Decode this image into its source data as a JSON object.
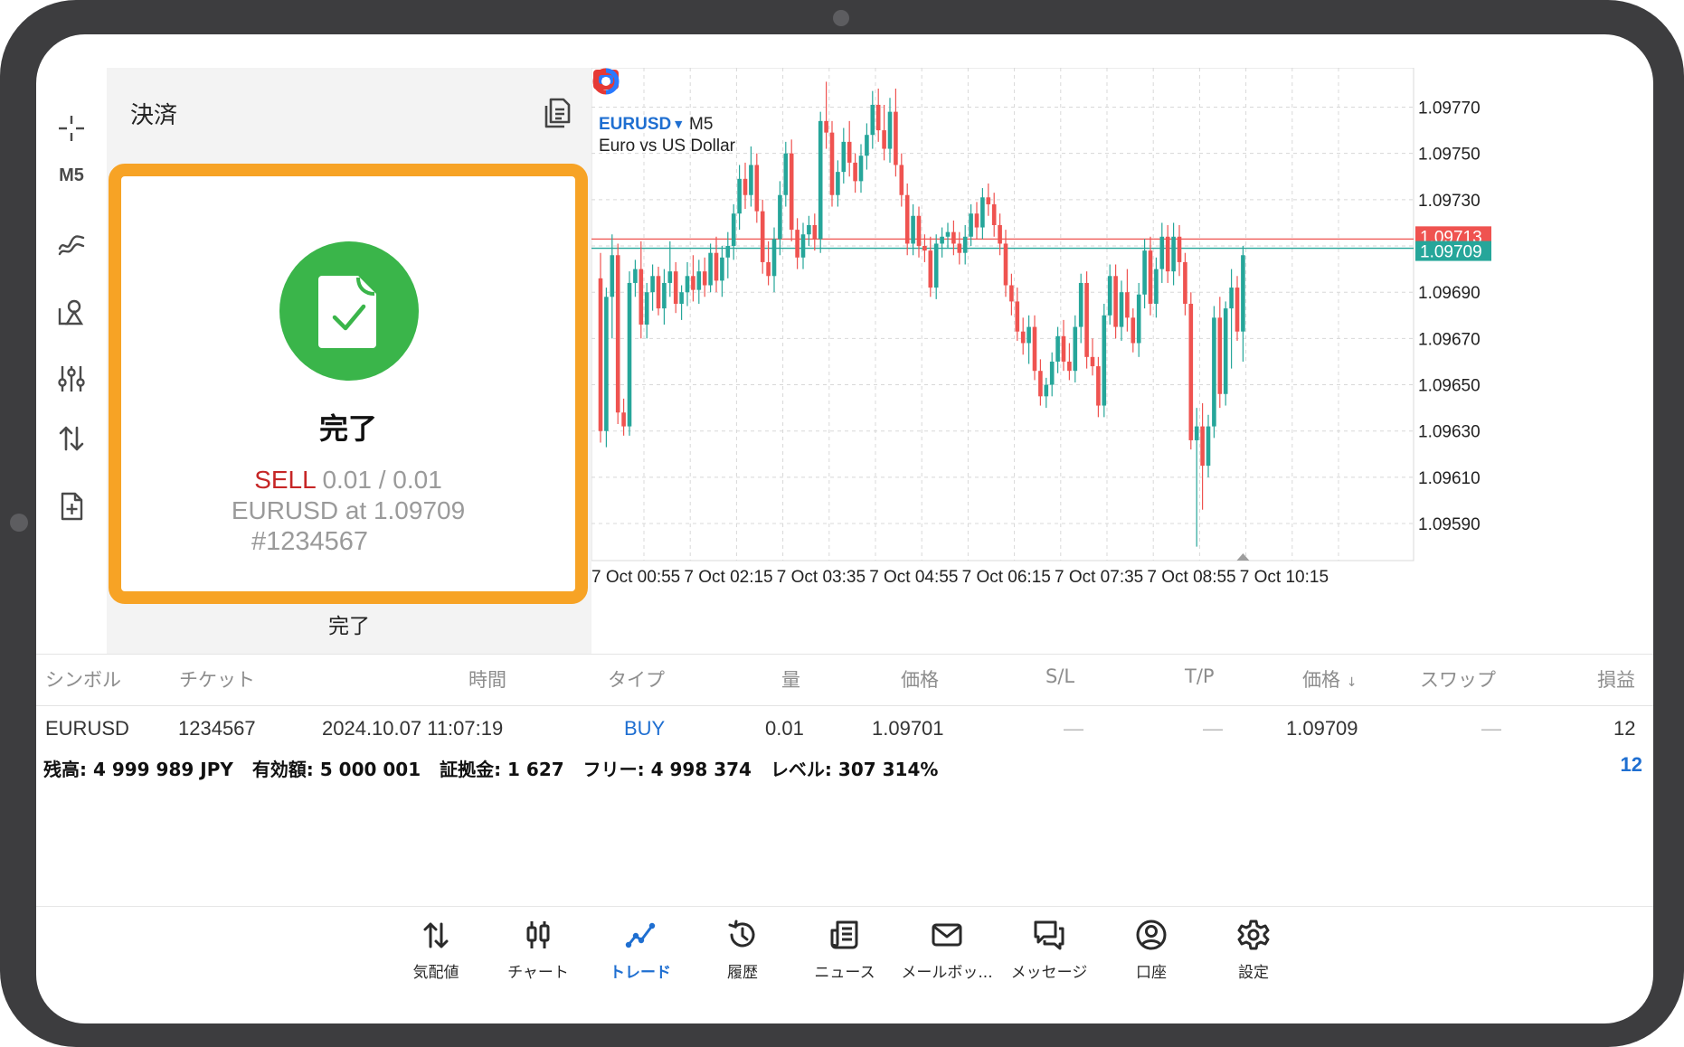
{
  "toolbar": {
    "timeframe": "M5",
    "icons": [
      "crosshair-icon",
      "indicator-icon",
      "objects-icon",
      "settings-sliders-icon",
      "trade-arrows-icon",
      "new-order-icon"
    ]
  },
  "order_panel": {
    "title": "決済",
    "result_title": "完了",
    "side": "SELL",
    "volume_text": "0.01 / 0.01",
    "instrument_text": "EURUSD at 1.09709",
    "ticket_text": "#1234567",
    "done_button": "完了",
    "accent_color": "#f7a325",
    "success_color": "#3ab54a"
  },
  "chart": {
    "symbol": "EURUSD",
    "timeframe": "M5",
    "description": "Euro vs US Dollar",
    "up_color": "#26a69a",
    "down_color": "#ef5350"
  },
  "chart_data": {
    "type": "candlestick",
    "y_ticks": [
      "1.09770",
      "1.09750",
      "1.09730",
      "1.09690",
      "1.09670",
      "1.09650",
      "1.09630",
      "1.09610",
      "1.09590"
    ],
    "y_tick_values": [
      1.0977,
      1.0975,
      1.0973,
      1.0969,
      1.0967,
      1.0965,
      1.0963,
      1.0961,
      1.0959
    ],
    "ylim": [
      1.09574,
      1.09787
    ],
    "x_ticks": [
      "7 Oct 00:55",
      "7 Oct 02:15",
      "7 Oct 03:35",
      "7 Oct 04:55",
      "7 Oct 06:15",
      "7 Oct 07:35",
      "7 Oct 08:55",
      "7 Oct 10:15"
    ],
    "x_tick_index": [
      0,
      16,
      32,
      48,
      64,
      80,
      96,
      112
    ],
    "levels": [
      {
        "label": "1.09713",
        "value": 1.09713,
        "color": "#ef5350"
      },
      {
        "label": "1.09709",
        "value": 1.09709,
        "color": "#26a69a"
      }
    ],
    "grid": true,
    "ohlc": [
      [
        1.09696,
        1.09707,
        1.09625,
        1.0963
      ],
      [
        1.0963,
        1.09692,
        1.09623,
        1.09688
      ],
      [
        1.09688,
        1.09715,
        1.0967,
        1.09706
      ],
      [
        1.09706,
        1.09711,
        1.09633,
        1.09638
      ],
      [
        1.09638,
        1.09644,
        1.09628,
        1.09632
      ],
      [
        1.09632,
        1.09699,
        1.09628,
        1.09694
      ],
      [
        1.09694,
        1.09704,
        1.09688,
        1.097
      ],
      [
        1.097,
        1.09712,
        1.0967,
        1.09676
      ],
      [
        1.09676,
        1.09694,
        1.0967,
        1.0969
      ],
      [
        1.0969,
        1.09702,
        1.09682,
        1.09697
      ],
      [
        1.09697,
        1.09701,
        1.0968,
        1.09683
      ],
      [
        1.09683,
        1.097,
        1.09676,
        1.09694
      ],
      [
        1.09694,
        1.09712,
        1.09688,
        1.09699
      ],
      [
        1.09699,
        1.09703,
        1.09681,
        1.09685
      ],
      [
        1.09685,
        1.09693,
        1.09678,
        1.0969
      ],
      [
        1.0969,
        1.09703,
        1.09684,
        1.09697
      ],
      [
        1.09697,
        1.09706,
        1.09686,
        1.09691
      ],
      [
        1.09691,
        1.09704,
        1.09685,
        1.09699
      ],
      [
        1.09699,
        1.09705,
        1.09688,
        1.09693
      ],
      [
        1.09693,
        1.09711,
        1.0969,
        1.09707
      ],
      [
        1.09707,
        1.09714,
        1.0969,
        1.09695
      ],
      [
        1.09695,
        1.0971,
        1.09688,
        1.09705
      ],
      [
        1.09705,
        1.09716,
        1.09696,
        1.0971
      ],
      [
        1.0971,
        1.09728,
        1.09704,
        1.09724
      ],
      [
        1.09724,
        1.09745,
        1.09717,
        1.09739
      ],
      [
        1.09739,
        1.09746,
        1.09726,
        1.09732
      ],
      [
        1.09732,
        1.09753,
        1.09727,
        1.09745
      ],
      [
        1.09745,
        1.0975,
        1.0972,
        1.09725
      ],
      [
        1.09725,
        1.0973,
        1.09698,
        1.09703
      ],
      [
        1.09703,
        1.09712,
        1.09693,
        1.09697
      ],
      [
        1.09697,
        1.09718,
        1.0969,
        1.09713
      ],
      [
        1.09713,
        1.09738,
        1.09706,
        1.09732
      ],
      [
        1.09732,
        1.09755,
        1.09727,
        1.0975
      ],
      [
        1.0975,
        1.09756,
        1.09712,
        1.09717
      ],
      [
        1.09717,
        1.09722,
        1.097,
        1.09705
      ],
      [
        1.09705,
        1.0972,
        1.097,
        1.09715
      ],
      [
        1.09715,
        1.09723,
        1.0971,
        1.09719
      ],
      [
        1.09719,
        1.09724,
        1.09708,
        1.09713
      ],
      [
        1.09713,
        1.09768,
        1.09707,
        1.09764
      ],
      [
        1.09764,
        1.09781,
        1.09752,
        1.09759
      ],
      [
        1.09759,
        1.09764,
        1.09727,
        1.09732
      ],
      [
        1.09732,
        1.09747,
        1.09727,
        1.09742
      ],
      [
        1.09742,
        1.09761,
        1.09737,
        1.09755
      ],
      [
        1.09755,
        1.09764,
        1.0974,
        1.09746
      ],
      [
        1.09746,
        1.0975,
        1.09733,
        1.09738
      ],
      [
        1.09738,
        1.09754,
        1.09733,
        1.09749
      ],
      [
        1.09749,
        1.09763,
        1.09743,
        1.09758
      ],
      [
        1.09758,
        1.09777,
        1.09752,
        1.09771
      ],
      [
        1.09771,
        1.09778,
        1.09755,
        1.0976
      ],
      [
        1.0976,
        1.09771,
        1.09747,
        1.09752
      ],
      [
        1.09752,
        1.09774,
        1.09746,
        1.09768
      ],
      [
        1.09768,
        1.09778,
        1.0974,
        1.09745
      ],
      [
        1.09745,
        1.0975,
        1.09727,
        1.09732
      ],
      [
        1.09732,
        1.09737,
        1.09706,
        1.09711
      ],
      [
        1.09711,
        1.09728,
        1.09706,
        1.09723
      ],
      [
        1.09723,
        1.09727,
        1.09705,
        1.0971
      ],
      [
        1.0971,
        1.09715,
        1.09703,
        1.09708
      ],
      [
        1.09708,
        1.09714,
        1.09688,
        1.09692
      ],
      [
        1.09692,
        1.09715,
        1.09687,
        1.09711
      ],
      [
        1.09711,
        1.09718,
        1.09705,
        1.09714
      ],
      [
        1.09714,
        1.0972,
        1.09709,
        1.09716
      ],
      [
        1.09716,
        1.09721,
        1.09706,
        1.09711
      ],
      [
        1.09711,
        1.09716,
        1.09702,
        1.09707
      ],
      [
        1.09707,
        1.09719,
        1.09702,
        1.09714
      ],
      [
        1.09714,
        1.09728,
        1.0971,
        1.09724
      ],
      [
        1.09724,
        1.09729,
        1.09713,
        1.09718
      ],
      [
        1.09718,
        1.09735,
        1.09713,
        1.09731
      ],
      [
        1.09731,
        1.09737,
        1.09723,
        1.09728
      ],
      [
        1.09728,
        1.09733,
        1.09714,
        1.09719
      ],
      [
        1.09719,
        1.09724,
        1.09706,
        1.09711
      ],
      [
        1.09711,
        1.09717,
        1.09688,
        1.09693
      ],
      [
        1.09693,
        1.09698,
        1.0968,
        1.09686
      ],
      [
        1.09686,
        1.09692,
        1.09669,
        1.09673
      ],
      [
        1.09673,
        1.09679,
        1.09663,
        1.09668
      ],
      [
        1.09668,
        1.0968,
        1.09659,
        1.09675
      ],
      [
        1.09675,
        1.0968,
        1.09652,
        1.09656
      ],
      [
        1.09656,
        1.09661,
        1.09641,
        1.09645
      ],
      [
        1.09645,
        1.09653,
        1.0964,
        1.0965
      ],
      [
        1.0965,
        1.09664,
        1.09645,
        1.0966
      ],
      [
        1.0966,
        1.09675,
        1.09655,
        1.09671
      ],
      [
        1.09671,
        1.09678,
        1.09656,
        1.0966
      ],
      [
        1.0966,
        1.09668,
        1.09652,
        1.09656
      ],
      [
        1.09656,
        1.0968,
        1.09651,
        1.09675
      ],
      [
        1.09675,
        1.09698,
        1.09668,
        1.09694
      ],
      [
        1.09694,
        1.09699,
        1.09657,
        1.09662
      ],
      [
        1.09662,
        1.0967,
        1.09654,
        1.09658
      ],
      [
        1.09658,
        1.09662,
        1.09636,
        1.09641
      ],
      [
        1.09641,
        1.09685,
        1.09636,
        1.0968
      ],
      [
        1.0968,
        1.09702,
        1.09676,
        1.09697
      ],
      [
        1.09697,
        1.09702,
        1.0967,
        1.09675
      ],
      [
        1.09675,
        1.09695,
        1.09669,
        1.0969
      ],
      [
        1.0969,
        1.097,
        1.09673,
        1.09679
      ],
      [
        1.09679,
        1.09683,
        1.09664,
        1.09668
      ],
      [
        1.09668,
        1.09694,
        1.09662,
        1.09689
      ],
      [
        1.09689,
        1.09713,
        1.09683,
        1.09708
      ],
      [
        1.09708,
        1.09714,
        1.0968,
        1.09685
      ],
      [
        1.09685,
        1.09705,
        1.09679,
        1.097
      ],
      [
        1.097,
        1.0972,
        1.09694,
        1.09714
      ],
      [
        1.09714,
        1.09719,
        1.09694,
        1.09699
      ],
      [
        1.09699,
        1.0972,
        1.09693,
        1.09714
      ],
      [
        1.09714,
        1.09719,
        1.09697,
        1.09703
      ],
      [
        1.09703,
        1.09707,
        1.0968,
        1.09685
      ],
      [
        1.09685,
        1.0969,
        1.09622,
        1.09626
      ],
      [
        1.09626,
        1.0964,
        1.0958,
        1.09632
      ],
      [
        1.09632,
        1.09642,
        1.09596,
        1.09615
      ],
      [
        1.09615,
        1.09637,
        1.0961,
        1.09632
      ],
      [
        1.09632,
        1.09684,
        1.09627,
        1.09679
      ],
      [
        1.09679,
        1.09688,
        1.0964,
        1.09646
      ],
      [
        1.09646,
        1.09686,
        1.09641,
        1.09683
      ],
      [
        1.09683,
        1.097,
        1.09657,
        1.09692
      ],
      [
        1.09692,
        1.09697,
        1.09669,
        1.09673
      ],
      [
        1.09673,
        1.0971,
        1.0966,
        1.09706
      ]
    ]
  },
  "positions": {
    "headers": [
      "シンボル",
      "チケット",
      "時間",
      "タイプ",
      "量",
      "価格",
      "S/L",
      "T/P",
      "価格",
      "スワップ",
      "損益"
    ],
    "sort_indicator": "↓",
    "row": {
      "symbol": "EURUSD",
      "ticket": "1234567",
      "time": "2024.10.07 11:07:19",
      "type": "BUY",
      "volume": "0.01",
      "open_price": "1.09701",
      "sl": "—",
      "tp": "—",
      "price": "1.09709",
      "swap": "—",
      "profit": "12"
    },
    "summary": {
      "balance": "残高:  4 999 989 JPY",
      "equity": "有効額:  5 000 001",
      "margin": "証拠金:  1 627",
      "free": "フリー:  4 998 374",
      "level": "レベル:  307 314%",
      "total_profit": "12"
    }
  },
  "nav": {
    "active_color": "#1f6fd1",
    "items": [
      {
        "label": "気配値",
        "icon": "quotes-icon"
      },
      {
        "label": "チャート",
        "icon": "chart-icon"
      },
      {
        "label": "トレード",
        "icon": "trade-icon"
      },
      {
        "label": "履歴",
        "icon": "history-icon"
      },
      {
        "label": "ニュース",
        "icon": "news-icon"
      },
      {
        "label": "メールボッ...",
        "icon": "mailbox-icon"
      },
      {
        "label": "メッセージ",
        "icon": "messages-icon"
      },
      {
        "label": "口座",
        "icon": "account-icon"
      },
      {
        "label": "設定",
        "icon": "settings-icon"
      }
    ]
  }
}
